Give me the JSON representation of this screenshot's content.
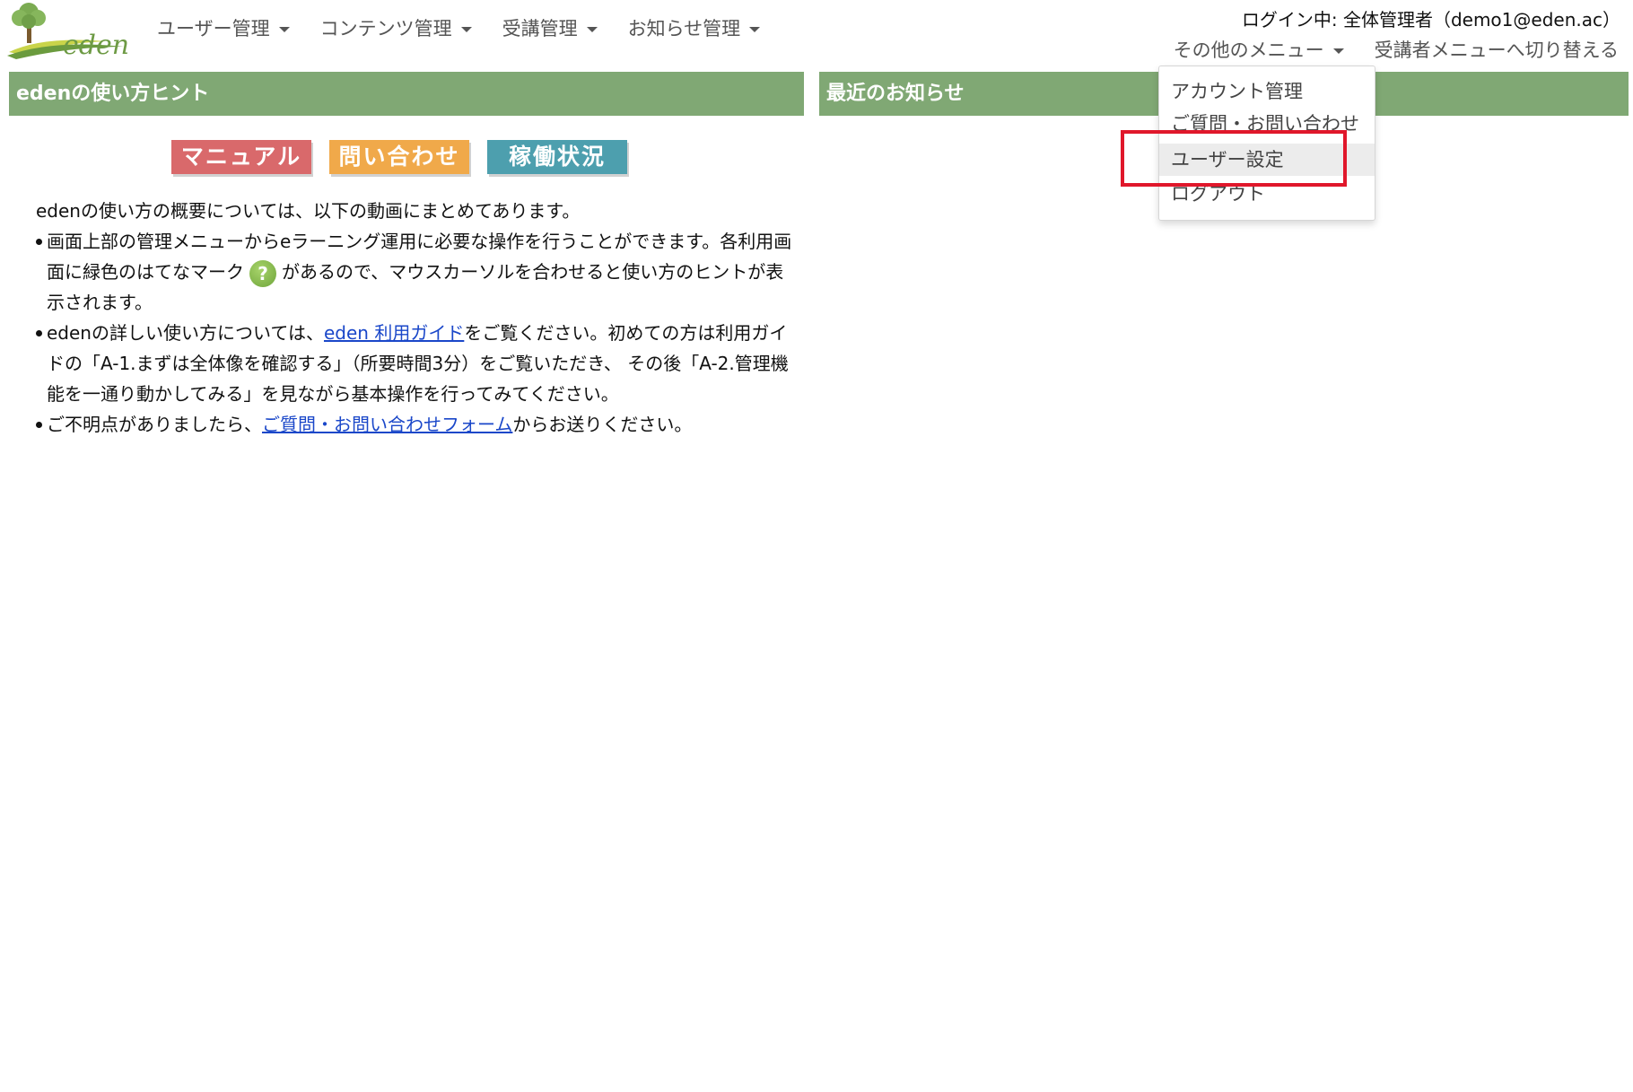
{
  "header": {
    "logo_text": "eden",
    "nav_items": [
      {
        "label": "ユーザー管理"
      },
      {
        "label": "コンテンツ管理"
      },
      {
        "label": "受講管理"
      },
      {
        "label": "お知らせ管理"
      }
    ],
    "login_info": "ログイン中: 全体管理者（demo1@eden.ac）",
    "other_menu_label": "その他のメニュー",
    "switch_label": "受講者メニューへ切り替える"
  },
  "left_panel": {
    "title": "edenの使い方ヒント",
    "buttons": {
      "manual": "マニュアル",
      "contact": "問い合わせ",
      "status": "稼働状況"
    },
    "intro": "edenの使い方の概要については、以下の動画にまとめてあります。",
    "bullet1_a": "画面上部の管理メニューからeラーニング運用に必要な操作を行うことができます。各利用画面に緑色のはてなマーク",
    "bullet1_icon": "?",
    "bullet1_b": "があるので、マウスカーソルを合わせると使い方のヒントが表示されます。",
    "bullet2_a": "edenの詳しい使い方については、",
    "bullet2_link": "eden 利用ガイド",
    "bullet2_b": "をご覧ください。初めての方は利用ガイドの「A-1.まずは全体像を確認する」（所要時間3分）をご覧いただき、 その後「A-2.管理機能を一通り動かしてみる」を見ながら基本操作を行ってみてください。",
    "bullet3_a": "ご不明点がありましたら、",
    "bullet3_link": "ご質問・お問い合わせフォーム",
    "bullet3_b": "からお送りください。"
  },
  "right_panel": {
    "title": "最近のお知らせ"
  },
  "dropdown": {
    "items": [
      {
        "label": "アカウント管理"
      },
      {
        "label": "ご質問・お問い合わせ"
      },
      {
        "label": "ユーザー設定"
      },
      {
        "label": "ログアウト"
      }
    ]
  },
  "colors": {
    "header_green": "#80a874",
    "highlight_red": "#e0172b",
    "link_blue": "#1a47c9"
  }
}
